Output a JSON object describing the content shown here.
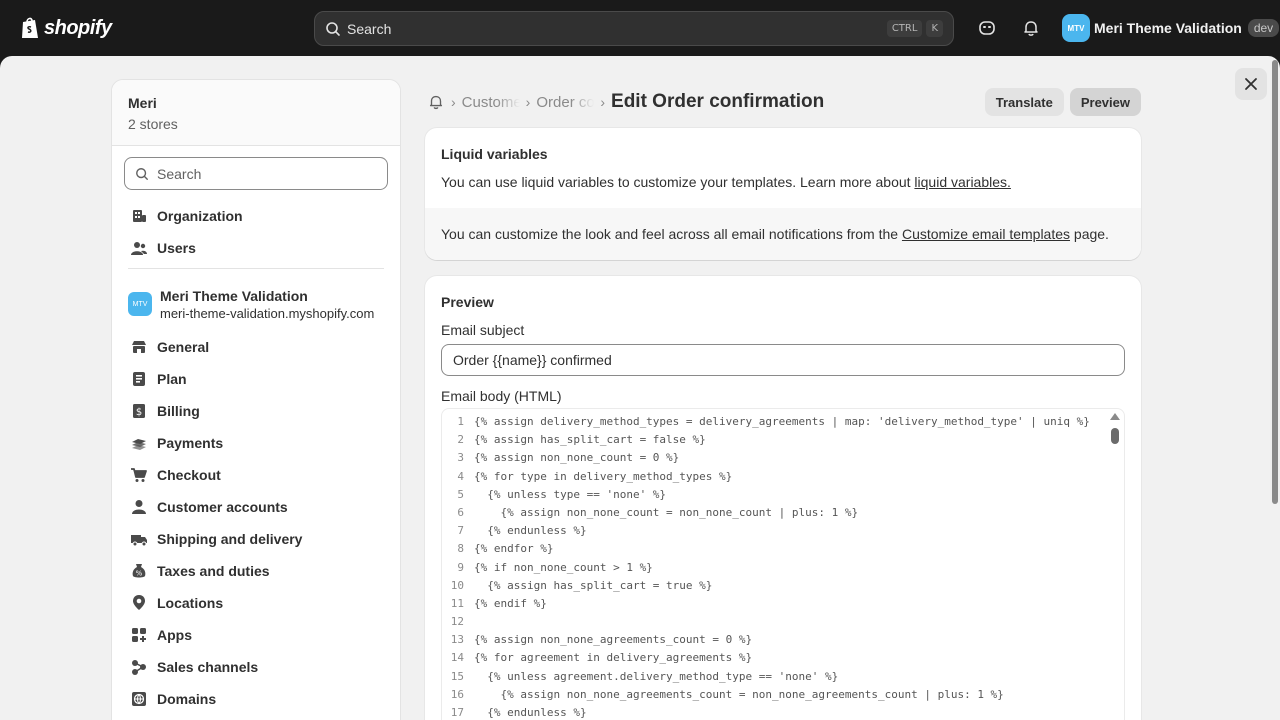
{
  "topbar": {
    "logo_text": "shopify",
    "search_placeholder": "Search",
    "shortcut_1": "CTRL",
    "shortcut_2": "K",
    "store_avatar": "MTV",
    "store_name": "Meri Theme Validation",
    "store_badge": "dev"
  },
  "sidebar": {
    "org_name": "Meri",
    "org_sub": "2 stores",
    "search_placeholder": "Search",
    "org_items": [
      {
        "label": "Organization",
        "icon": "organization-icon"
      },
      {
        "label": "Users",
        "icon": "users-icon"
      }
    ],
    "store": {
      "avatar": "MTV",
      "name": "Meri Theme Validation",
      "domain": "meri-theme-validation.myshopify.com"
    },
    "settings_items": [
      {
        "label": "General",
        "icon": "store-icon"
      },
      {
        "label": "Plan",
        "icon": "plan-icon"
      },
      {
        "label": "Billing",
        "icon": "billing-icon"
      },
      {
        "label": "Payments",
        "icon": "payments-icon"
      },
      {
        "label": "Checkout",
        "icon": "cart-icon"
      },
      {
        "label": "Customer accounts",
        "icon": "person-icon"
      },
      {
        "label": "Shipping and delivery",
        "icon": "truck-icon"
      },
      {
        "label": "Taxes and duties",
        "icon": "tax-icon"
      },
      {
        "label": "Locations",
        "icon": "location-icon"
      },
      {
        "label": "Apps",
        "icon": "apps-icon"
      },
      {
        "label": "Sales channels",
        "icon": "channels-icon"
      },
      {
        "label": "Domains",
        "icon": "globe-icon"
      }
    ]
  },
  "header": {
    "crumb_1": "Customer notifications",
    "crumb_2": "Order confirmation",
    "title": "Edit Order confirmation",
    "translate_label": "Translate",
    "preview_label": "Preview"
  },
  "liquid_card": {
    "title": "Liquid variables",
    "text": "You can use liquid variables to customize your templates. Learn more about ",
    "link": "liquid variables.",
    "note_pre": "You can customize the look and feel across all email notifications from the ",
    "note_link": "Customize email templates",
    "note_post": " page."
  },
  "preview_card": {
    "title": "Preview",
    "subject_label": "Email subject",
    "subject_value": "Order {{name}} confirmed",
    "body_label": "Email body (HTML)",
    "code": [
      {
        "n": "1",
        "text": "{% assign delivery_method_types = delivery_agreements | map: 'delivery_method_type' | uniq %}"
      },
      {
        "n": "2",
        "text": "{% assign has_split_cart = false %}"
      },
      {
        "n": "3",
        "text": "{% assign non_none_count = 0 %}"
      },
      {
        "n": "4",
        "text": "{% for type in delivery_method_types %}"
      },
      {
        "n": "5",
        "text": "  {% unless type == 'none' %}"
      },
      {
        "n": "6",
        "text": "    {% assign non_none_count = non_none_count | plus: 1 %}"
      },
      {
        "n": "7",
        "text": "  {% endunless %}"
      },
      {
        "n": "8",
        "text": "{% endfor %}"
      },
      {
        "n": "9",
        "text": "{% if non_none_count > 1 %}"
      },
      {
        "n": "10",
        "text": "  {% assign has_split_cart = true %}"
      },
      {
        "n": "11",
        "text": "{% endif %}"
      },
      {
        "n": "12",
        "text": ""
      },
      {
        "n": "13",
        "text": "{% assign non_none_agreements_count = 0 %}"
      },
      {
        "n": "14",
        "text": "{% for agreement in delivery_agreements %}"
      },
      {
        "n": "15",
        "text": "  {% unless agreement.delivery_method_type == 'none' %}"
      },
      {
        "n": "16",
        "text": "    {% assign non_none_agreements_count = non_none_agreements_count | plus: 1 %}"
      },
      {
        "n": "17",
        "text": "  {% endunless %}"
      }
    ]
  }
}
